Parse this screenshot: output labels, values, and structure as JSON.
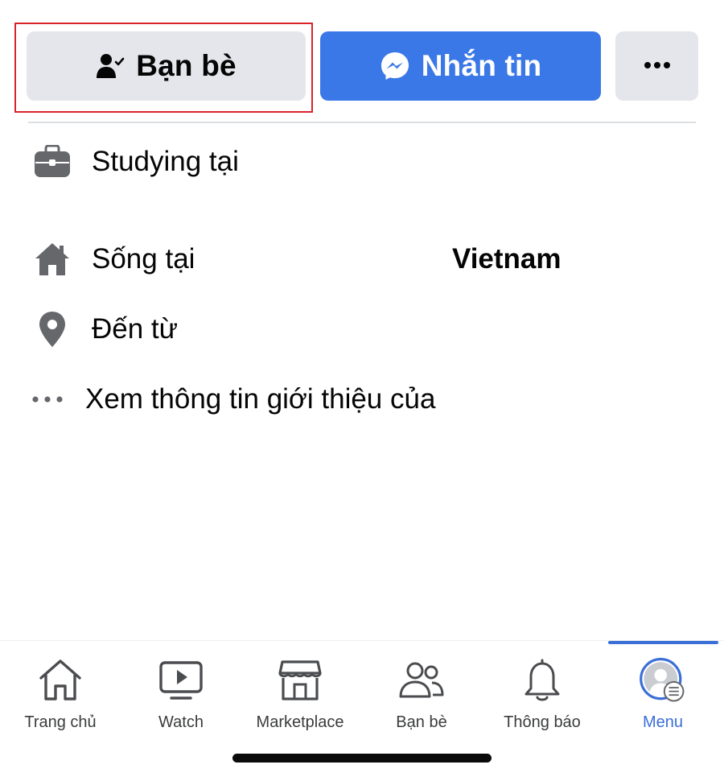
{
  "actions": {
    "friends_label": "Bạn bè",
    "message_label": "Nhắn tin",
    "more_icon": "more-horizontal-icon"
  },
  "info": {
    "work": {
      "label": "Studying tại",
      "icon": "briefcase-icon"
    },
    "lives": {
      "label": "Sống tại",
      "value": "Vietnam",
      "icon": "home-icon"
    },
    "from": {
      "label": "Đến từ",
      "icon": "location-pin-icon"
    },
    "about": {
      "label": "Xem thông tin giới thiệu của",
      "icon": "more-dots-icon"
    }
  },
  "nav": {
    "items": [
      {
        "label": "Trang chủ",
        "icon": "home-outline-icon"
      },
      {
        "label": "Watch",
        "icon": "video-icon"
      },
      {
        "label": "Marketplace",
        "icon": "store-icon"
      },
      {
        "label": "Bạn bè",
        "icon": "friends-icon"
      },
      {
        "label": "Thông báo",
        "icon": "bell-icon"
      },
      {
        "label": "Menu",
        "icon": "avatar-menu-icon"
      }
    ],
    "active": "Menu"
  },
  "colors": {
    "accent": "#3b78e7",
    "highlight": "#d9232b",
    "button_gray": "#e4e6eb",
    "nav_active": "#3b6fd8"
  }
}
